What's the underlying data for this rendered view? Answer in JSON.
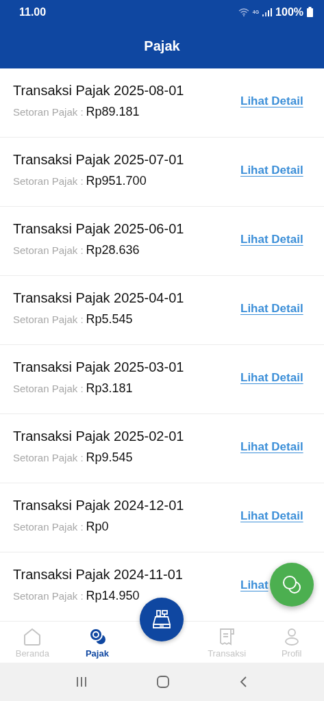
{
  "status_bar": {
    "time": "11.00",
    "network": "4G",
    "battery": "100%"
  },
  "header": {
    "title": "Pajak"
  },
  "transactions": [
    {
      "title": "Transaksi Pajak 2025-08-01",
      "label": "Setoran Pajak :",
      "amount": "Rp89.181",
      "link": "Lihat Detail"
    },
    {
      "title": "Transaksi Pajak 2025-07-01",
      "label": "Setoran Pajak :",
      "amount": "Rp951.700",
      "link": "Lihat Detail"
    },
    {
      "title": "Transaksi Pajak 2025-06-01",
      "label": "Setoran Pajak :",
      "amount": "Rp28.636",
      "link": "Lihat Detail"
    },
    {
      "title": "Transaksi Pajak 2025-04-01",
      "label": "Setoran Pajak :",
      "amount": "Rp5.545",
      "link": "Lihat Detail"
    },
    {
      "title": "Transaksi Pajak 2025-03-01",
      "label": "Setoran Pajak :",
      "amount": "Rp3.181",
      "link": "Lihat Detail"
    },
    {
      "title": "Transaksi Pajak 2025-02-01",
      "label": "Setoran Pajak :",
      "amount": "Rp9.545",
      "link": "Lihat Detail"
    },
    {
      "title": "Transaksi Pajak 2024-12-01",
      "label": "Setoran Pajak :",
      "amount": "Rp0",
      "link": "Lihat Detail"
    },
    {
      "title": "Transaksi Pajak 2024-11-01",
      "label": "Setoran Pajak :",
      "amount": "Rp14.950",
      "link": "Lihat"
    }
  ],
  "bottom_nav": [
    {
      "kind": "home",
      "label": "Beranda",
      "selected": false
    },
    {
      "kind": "tax",
      "label": "Pajak",
      "selected": true
    },
    {
      "kind": "cashier",
      "selected": false
    },
    {
      "kind": "receipt",
      "label": "Transaksi",
      "selected": false
    },
    {
      "kind": "profile",
      "label": "Profil",
      "selected": false
    }
  ]
}
